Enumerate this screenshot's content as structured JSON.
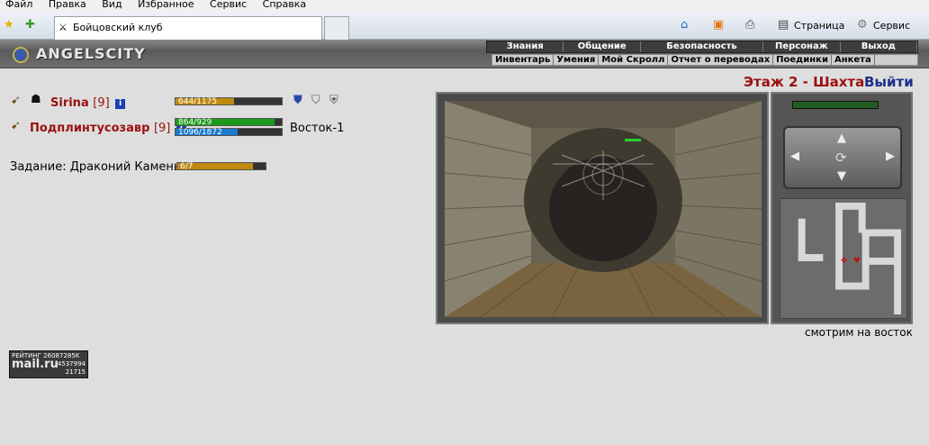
{
  "browser": {
    "menu": [
      "Файл",
      "Правка",
      "Вид",
      "Избранное",
      "Сервис",
      "Справка"
    ],
    "tab_title": "Бойцовский клуб",
    "page_label": "Страница",
    "service_label": "Сервис"
  },
  "site": {
    "logo_text": "ANGELSCITY",
    "nav_main": [
      "Знания",
      "Общение",
      "Безопасность",
      "Персонаж",
      "Выход"
    ],
    "nav_sub": [
      "Инвентарь",
      "Умения",
      "Мой Скролл",
      "Отчет о переводах",
      "Поединки",
      "Анкета"
    ]
  },
  "players": [
    {
      "name": "Sirina",
      "level": "[9]",
      "hp": "644/1175",
      "hp_fraction": 0.548,
      "hp_color": "#c08a10"
    },
    {
      "name": "Подплинтусозавр",
      "level": "[9]",
      "hp": "864/929",
      "hp_fraction": 0.93,
      "hp_color": "#1a9a1a",
      "mana": "1096/1872",
      "mana_fraction": 0.586,
      "mana_color": "#1a7ad0",
      "location": "Восток-1"
    }
  ],
  "quest": {
    "label": "Задание: Драконий Камень",
    "progress": "6/7",
    "progress_fraction": 0.857,
    "color": "#c08a10"
  },
  "dungeon": {
    "floor": "Этаж 2 - Шахта",
    "exit": "Выйти",
    "facing": "смотрим на восток"
  },
  "rating": {
    "label": "РЕЙТИНГ",
    "value1": "26087285K",
    "brand": "mail.ru",
    "value2": "4537994",
    "value3": "21715"
  },
  "colors": {
    "player_name": "#9b1010",
    "exit_link": "#1b2f8c"
  }
}
